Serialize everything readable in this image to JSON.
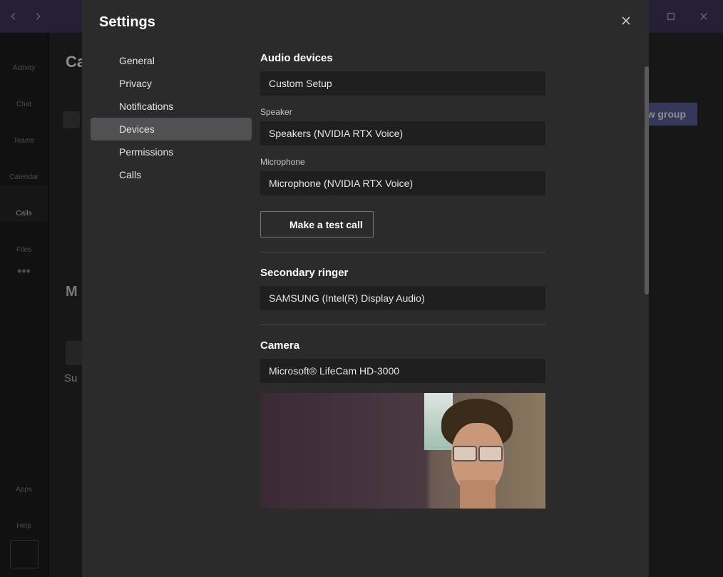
{
  "rail": {
    "activity": "Activity",
    "chat": "Chat",
    "teams": "Teams",
    "calendar": "Calendar",
    "calls": "Calls",
    "files": "Files",
    "apps": "Apps",
    "help": "Help"
  },
  "background": {
    "header": "Ca",
    "new_group": "w group",
    "letter_m": "M",
    "su": "Su"
  },
  "modal": {
    "title": "Settings"
  },
  "nav": {
    "general": "General",
    "privacy": "Privacy",
    "notifications": "Notifications",
    "devices": "Devices",
    "permissions": "Permissions",
    "calls": "Calls"
  },
  "content": {
    "audio_devices_title": "Audio devices",
    "audio_setup_select": "Custom Setup",
    "speaker_label": "Speaker",
    "speaker_select": "Speakers (NVIDIA RTX Voice)",
    "microphone_label": "Microphone",
    "microphone_select": "Microphone (NVIDIA RTX Voice)",
    "test_call": "Make a test call",
    "secondary_ringer_title": "Secondary ringer",
    "secondary_ringer_select": "SAMSUNG (Intel(R) Display Audio)",
    "camera_title": "Camera",
    "camera_select": "Microsoft® LifeCam HD-3000"
  }
}
